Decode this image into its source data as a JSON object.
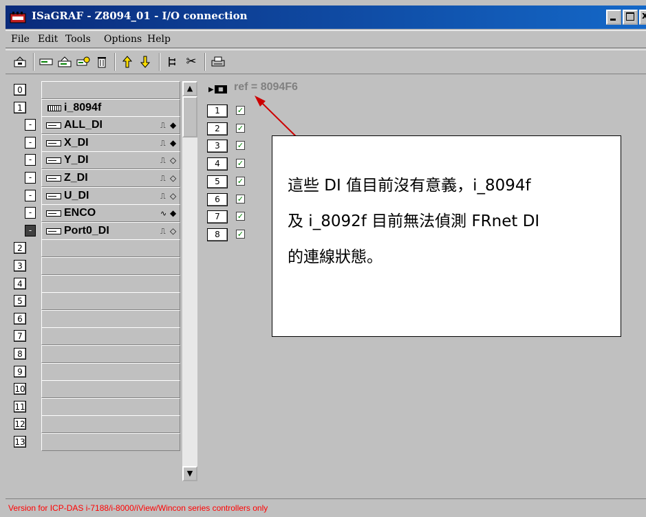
{
  "window": {
    "title": "ISaGRAF - Z8094_01 - I/O connection",
    "controls": {
      "minimize": "-",
      "maximize": "□",
      "close": "x"
    }
  },
  "menu": [
    "File",
    "Edit",
    "Tools",
    "Options",
    "Help"
  ],
  "toolbar": {
    "buttons": [
      {
        "icon": "open-board-icon"
      },
      {
        "icon": "card-icon"
      },
      {
        "icon": "card-write-icon"
      },
      {
        "icon": "card-parameters-icon"
      },
      {
        "icon": "delete-icon"
      },
      {
        "icon": "move-up-icon",
        "glyph": "⇧",
        "color": "#ffd700"
      },
      {
        "icon": "move-down-icon",
        "glyph": "⇩",
        "color": "#ffd700"
      },
      {
        "icon": "tree-icon"
      },
      {
        "icon": "cut-icon",
        "glyph": "✂"
      },
      {
        "icon": "print-icon"
      }
    ]
  },
  "slots": [
    {
      "number": "0",
      "label": ""
    },
    {
      "number": "1",
      "label": "i_8094f"
    },
    {
      "number": "-",
      "label": "ALL_DI",
      "signal": "⎍",
      "dir": "◆"
    },
    {
      "number": "-",
      "label": "X_DI",
      "signal": "⎍",
      "dir": "◆"
    },
    {
      "number": "-",
      "label": "Y_DI",
      "signal": "⎍",
      "dir": "◇"
    },
    {
      "number": "-",
      "label": "Z_DI",
      "signal": "⎍",
      "dir": "◇"
    },
    {
      "number": "-",
      "label": "U_DI",
      "signal": "⎍",
      "dir": "◇"
    },
    {
      "number": "-",
      "label": "ENCO",
      "signal": "∿",
      "dir": "◆"
    },
    {
      "number": "-",
      "label": "Port0_DI",
      "signal": "⎍",
      "dir": "◇",
      "selected": true
    },
    {
      "number": "2",
      "label": ""
    },
    {
      "number": "3",
      "label": ""
    },
    {
      "number": "4",
      "label": ""
    },
    {
      "number": "5",
      "label": ""
    },
    {
      "number": "6",
      "label": ""
    },
    {
      "number": "7",
      "label": ""
    },
    {
      "number": "8",
      "label": ""
    },
    {
      "number": "9",
      "label": ""
    },
    {
      "number": "10",
      "label": ""
    },
    {
      "number": "11",
      "label": ""
    },
    {
      "number": "12",
      "label": ""
    },
    {
      "number": "13",
      "label": ""
    }
  ],
  "channels": {
    "ref": "ref = 8094F6",
    "items": [
      "1",
      "2",
      "3",
      "4",
      "5",
      "6",
      "7",
      "8"
    ],
    "check_glyph": "✓"
  },
  "annotation": {
    "text_line1": "這些 DI 值目前沒有意義，i_8094f",
    "text_line2": "及 i_8092f 目前無法偵測 FRnet DI",
    "text_line3": "的連線狀態。",
    "arrow_color": "#cc0000"
  },
  "status": "Version for ICP-DAS i-7188/i-8000/iView/Wincon series controllers only"
}
